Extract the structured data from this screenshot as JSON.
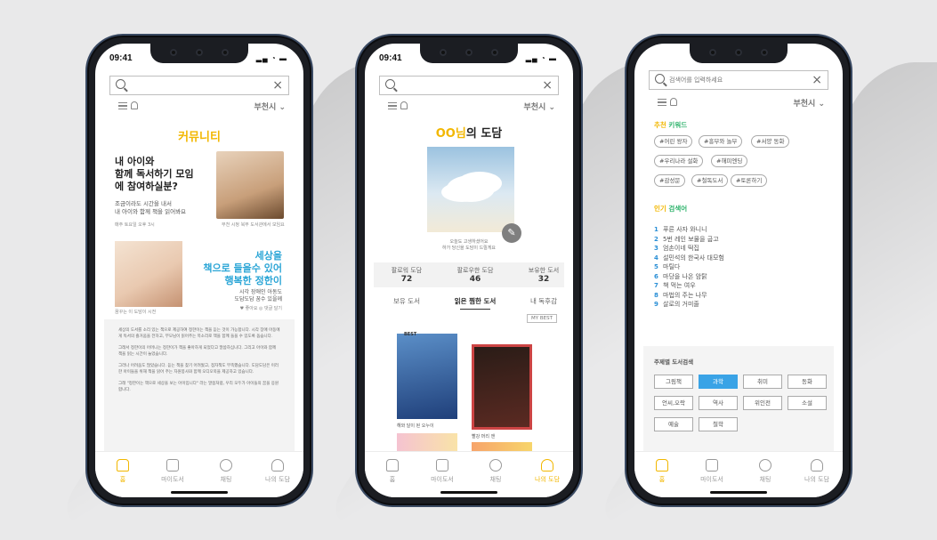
{
  "common": {
    "time": "09:41",
    "city": "부천시",
    "tabs": [
      "홈",
      "마이도서",
      "채팅",
      "나의 도담"
    ]
  },
  "phone1": {
    "title": "커뮤니티",
    "headline": [
      "내 아이와",
      "함께 독서하기 모임",
      "에 참여하실분?"
    ],
    "sub": [
      "조금이라도 시간을 내서",
      "내 아이와 함께 책을 읽어봐요"
    ],
    "cap1": "매주 토요일 오후 3시",
    "cap2": "부천 시청 북부 도서관에서 모임요",
    "cap3": "꿈꾸는 이 도담이 시전",
    "headline2": [
      "세상을",
      "책으로 들을수 있어",
      "행복한 정한이"
    ],
    "sub2": [
      "시각 장애인 아동도",
      "도담도담 꿈수 있을께"
    ],
    "meta": "♥ 좋아요  ◎ 댓글 달기",
    "body": [
      "세상의 도서를 소리 있는 책으로 제공하여 정한이는 책을 듣는 것이 가능합니다. 시각 장애 아동에게 독서의 즐거움을 전하고, 부모님이 읽어주는 목소리로 책을 함께 들을 수 있도록 돕습니다.",
      "그래서 정한이의 어머니는 정한이가 책을 좋아하게 되었다고 말씀하십니다. 그리고 아이와 함께 책을 읽는 시간이 늘었습니다.",
      "그러나 어려움도 많았습니다. 듣는 책을 찾기 어려웠고, 점자책도 부족했습니다. 도담도담은 이러한 아이들을 위해 책을 읽어 주는 자원봉사와 함께 오디오북을 제공하고 있습니다.",
      "그래 \"정한이는 책으로 세상을 보는 아이입니다\" 라는 말씀처럼, 우리 모두가 아이들의 꿈을 응원합니다."
    ]
  },
  "phone2": {
    "title_prefix": "OO님",
    "title_suffix": "의 도담",
    "caption": [
      "오늘도 고생하셨어요",
      "하가 당신을 도담이 드릴게요"
    ],
    "stats": [
      {
        "label": "팔로워 도담",
        "value": "72"
      },
      {
        "label": "팔로우한 도담",
        "value": "46"
      },
      {
        "label": "보유한 도서",
        "value": "32"
      }
    ],
    "tabs": [
      "보유 도서",
      "읽은 찜한 도서",
      "내 독후감"
    ],
    "mybest": "MY BEST",
    "best": "BEST",
    "book1": "해와 달이 된 오누이",
    "book2": "빨강 머리 앤"
  },
  "phone3": {
    "search_placeholder": "검색어를 입력하세요",
    "keyword_title": [
      "추천 ",
      "키워드"
    ],
    "keywords": [
      "#어린 왕자",
      "#흥부와 놀부",
      "#서양 동화",
      "#우리나라 설화",
      "#해피엔딩",
      "#감성문",
      "#철독도서",
      "#토론하기"
    ],
    "popular_title": [
      "인기 ",
      "검색어"
    ],
    "popular": [
      "푸른 사자 와니니",
      "5번 레인 보물을 굽고",
      "엄손이네 떡집",
      "설민석의 한국사 대모험",
      "마틸다",
      "마당을 나온 암탉",
      "책 먹는 여우",
      "마법의 주는 나무",
      "살로의 거미줄"
    ],
    "genre_title": "주제별 도서검색",
    "genres": [
      "그림책",
      "과학",
      "취미",
      "동화",
      "언씨,오락",
      "역사",
      "위인전",
      "소설",
      "예술",
      "철학"
    ]
  }
}
